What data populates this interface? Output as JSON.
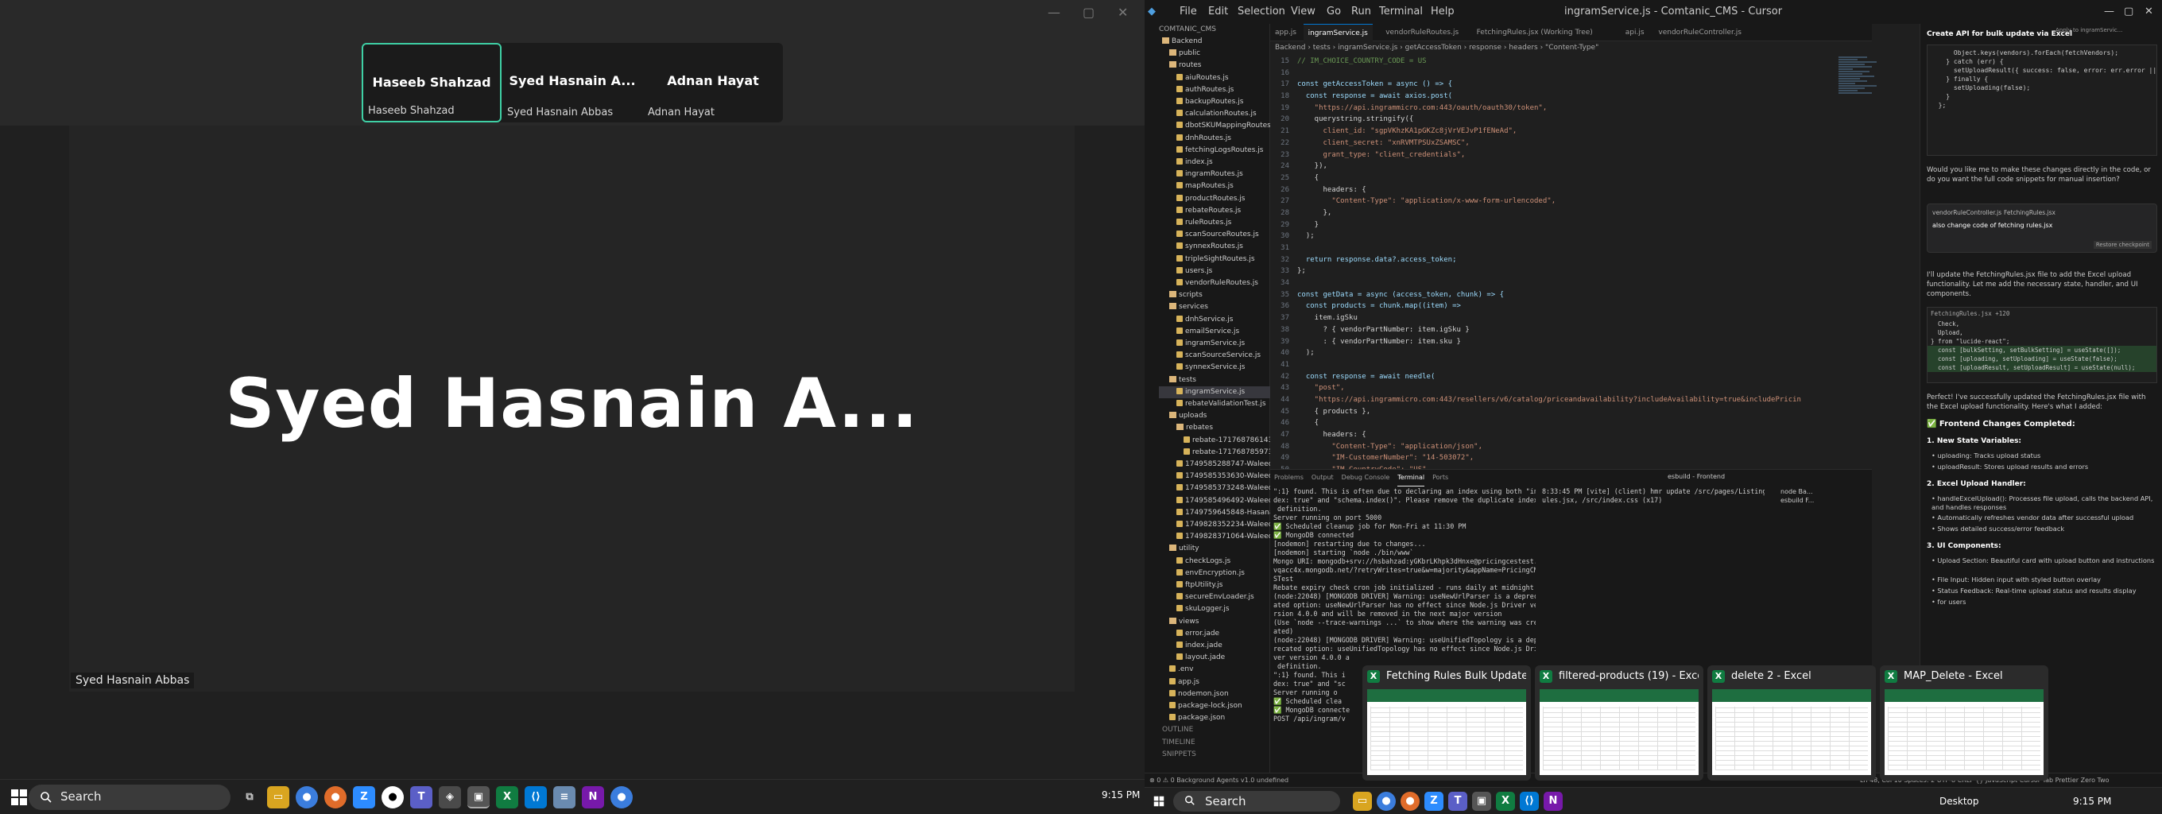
{
  "meeting": {
    "window_controls": [
      "—",
      "▢",
      "✕"
    ],
    "tiles": [
      {
        "name": "Haseeb Shahzad",
        "label": "Haseeb Shahzad",
        "active": true
      },
      {
        "name": "Syed Hasnain A...",
        "label": "Syed Hasnain Abbas",
        "active": false
      },
      {
        "name": "Adnan Hayat",
        "label": "Adnan Hayat",
        "active": false
      }
    ],
    "speaker_name": "Syed Hasnain A...",
    "speaker_label": "Syed Hasnain Abbas"
  },
  "taskbar1": {
    "search_placeholder": "Search",
    "time": "9:15 PM",
    "apps": [
      "file-explorer",
      "chrome",
      "chrome",
      "zoom",
      "chrome-dev",
      "app",
      "teams",
      "app",
      "excel",
      "vscode",
      "notepad",
      "onenote",
      "chrome"
    ]
  },
  "ide": {
    "window_title": "ingramService.js - Comtanic_CMS - Cursor",
    "menu": [
      "File",
      "Edit",
      "Selection",
      "View",
      "Go",
      "Run",
      "Terminal",
      "Help"
    ],
    "tabs": [
      "app.js",
      "ingramService.js",
      "vendorRuleRoutes.js",
      "FetchingRules.jsx (Working Tree)",
      "api.js",
      "vendorRuleController.js"
    ],
    "breadcrumb": "Backend › tests › ingramService.js › getAccessToken › response › headers › \"Content-Type\"",
    "explorer_title": "COMTANIC_CMS",
    "explorer": [
      {
        "label": "Backend",
        "type": "folder",
        "indent": 0
      },
      {
        "label": "public",
        "type": "folder",
        "indent": 1
      },
      {
        "label": "routes",
        "type": "folder",
        "indent": 1
      },
      {
        "label": "aiuRoutes.js",
        "type": "file",
        "indent": 2
      },
      {
        "label": "authRoutes.js",
        "type": "file",
        "indent": 2
      },
      {
        "label": "backupRoutes.js",
        "type": "file",
        "indent": 2
      },
      {
        "label": "calculationRoutes.js",
        "type": "file",
        "indent": 2
      },
      {
        "label": "dbotSKUMappingRoutes.js",
        "type": "file",
        "indent": 2
      },
      {
        "label": "dnhRoutes.js",
        "type": "file",
        "indent": 2
      },
      {
        "label": "fetchingLogsRoutes.js",
        "type": "file",
        "indent": 2
      },
      {
        "label": "index.js",
        "type": "file",
        "indent": 2
      },
      {
        "label": "ingramRoutes.js",
        "type": "file",
        "indent": 2
      },
      {
        "label": "mapRoutes.js",
        "type": "file",
        "indent": 2
      },
      {
        "label": "productRoutes.js",
        "type": "file",
        "indent": 2
      },
      {
        "label": "rebateRoutes.js",
        "type": "file",
        "indent": 2
      },
      {
        "label": "ruleRoutes.js",
        "type": "file",
        "indent": 2
      },
      {
        "label": "scanSourceRoutes.js",
        "type": "file",
        "indent": 2
      },
      {
        "label": "synnexRoutes.js",
        "type": "file",
        "indent": 2
      },
      {
        "label": "tripleSightRoutes.js",
        "type": "file",
        "indent": 2
      },
      {
        "label": "users.js",
        "type": "file",
        "indent": 2
      },
      {
        "label": "vendorRuleRoutes.js",
        "type": "file",
        "indent": 2
      },
      {
        "label": "scripts",
        "type": "folder",
        "indent": 1
      },
      {
        "label": "services",
        "type": "folder",
        "indent": 1
      },
      {
        "label": "dnhService.js",
        "type": "file",
        "indent": 2
      },
      {
        "label": "emailService.js",
        "type": "file",
        "indent": 2
      },
      {
        "label": "ingramService.js",
        "type": "file",
        "indent": 2
      },
      {
        "label": "scanSourceService.js",
        "type": "file",
        "indent": 2
      },
      {
        "label": "synnexService.js",
        "type": "file",
        "indent": 2
      },
      {
        "label": "tests",
        "type": "folder",
        "indent": 1
      },
      {
        "label": "ingramService.js",
        "type": "file",
        "indent": 2,
        "selected": true
      },
      {
        "label": "rebateValidationTest.js",
        "type": "file",
        "indent": 2
      },
      {
        "label": "uploads",
        "type": "folder",
        "indent": 1
      },
      {
        "label": "rebates",
        "type": "folder",
        "indent": 2
      },
      {
        "label": "rebate-1717687861434-1...",
        "type": "file",
        "indent": 3
      },
      {
        "label": "rebate-1717687859733-8...",
        "type": "file",
        "indent": 3
      },
      {
        "label": "1749585288747-Waleed ay...",
        "type": "file",
        "indent": 2
      },
      {
        "label": "1749585353630-Waleed ay...",
        "type": "file",
        "indent": 2
      },
      {
        "label": "1749585373248-Waleed ay...",
        "type": "file",
        "indent": 2
      },
      {
        "label": "1749585496492-Waleed ay...",
        "type": "file",
        "indent": 2
      },
      {
        "label": "1749759645848-Hasanat/A...",
        "type": "file",
        "indent": 2
      },
      {
        "label": "1749828352234-Waleed_m...",
        "type": "file",
        "indent": 2
      },
      {
        "label": "1749828371064-Waleed_m...",
        "type": "file",
        "indent": 2
      },
      {
        "label": "utility",
        "type": "folder",
        "indent": 1
      },
      {
        "label": "checkLogs.js",
        "type": "file",
        "indent": 2
      },
      {
        "label": "envEncryption.js",
        "type": "file",
        "indent": 2
      },
      {
        "label": "ftpUtility.js",
        "type": "file",
        "indent": 2
      },
      {
        "label": "secureEnvLoader.js",
        "type": "file",
        "indent": 2
      },
      {
        "label": "skuLogger.js",
        "type": "file",
        "indent": 2
      },
      {
        "label": "views",
        "type": "folder",
        "indent": 1
      },
      {
        "label": "error.jade",
        "type": "file",
        "indent": 2
      },
      {
        "label": "index.jade",
        "type": "file",
        "indent": 2
      },
      {
        "label": "layout.jade",
        "type": "file",
        "indent": 2
      },
      {
        "label": ".env",
        "type": "file",
        "indent": 1
      },
      {
        "label": "app.js",
        "type": "file",
        "indent": 1
      },
      {
        "label": "nodemon.json",
        "type": "file",
        "indent": 1
      },
      {
        "label": "package-lock.json",
        "type": "file",
        "indent": 1
      },
      {
        "label": "package.json",
        "type": "file",
        "indent": 1
      },
      {
        "label": "OUTLINE",
        "type": "section",
        "indent": 0
      },
      {
        "label": "TIMELINE",
        "type": "section",
        "indent": 0
      },
      {
        "label": "SNIPPETS",
        "type": "section",
        "indent": 0
      }
    ],
    "code_start_line": 15,
    "code": [
      "// IM_CHOICE_COUNTRY_CODE = US",
      "",
      "const getAccessToken = async () => {",
      "  const response = await axios.post(",
      "    \"https://api.ingrammicro.com:443/oauth/oauth30/token\",",
      "    querystring.stringify({",
      "      client_id: \"sgpVKhzKA1pGKZc8jVrVEJvP1fENeAd\",",
      "      client_secret: \"xnRVMTPSUxZSAMSC\",",
      "      grant_type: \"client_credentials\",",
      "    }),",
      "    {",
      "      headers: {",
      "        \"Content-Type\": \"application/x-www-form-urlencoded\",",
      "      },",
      "    }",
      "  );",
      "",
      "  return response.data?.access_token;",
      "};",
      "",
      "const getData = async (access_token, chunk) => {",
      "  const products = chunk.map((item) =>",
      "    item.igSku",
      "      ? { vendorPartNumber: item.igSku }",
      "      : { vendorPartNumber: item.sku }",
      "  );",
      "",
      "  const response = await needle(",
      "    \"post\",",
      "    \"https://api.ingrammicro.com:443/resellers/v6/catalog/priceandavailability?includeAvailability=true&includePricin",
      "    { products },",
      "    {",
      "      headers: {",
      "        \"Content-Type\": \"application/json\",",
      "        \"IM-CustomerNumber\": \"14-503072\",",
      "        \"IM-CountryCode\": \"US\",",
      "        \"IM-CorrelationID\": uuidv4(),",
      "        Authorization: \"Bearer \" + access_token,",
      "      },"
    ],
    "panel_tabs": [
      "Problems",
      "Output",
      "Debug Console",
      "Terminal",
      "Ports"
    ],
    "terminal_left": [
      "\":1} found. This is often due to declaring an index using both \"in",
      "dex: true\" and \"schema.index()\". Please remove the duplicate index",
      " definition.",
      "Server running on port 5000",
      "✅ Scheduled cleanup job for Mon-Fri at 11:30 PM",
      "✅ MongoDB connected",
      "[nodemon] restarting due to changes...",
      "[nodemon] starting `node ./bin/www`",
      "Mongo URI: mongodb+srv://hsbahzad:yGKbrLKhpk3dHnxe@pricingcestest.",
      "vqacc4x.mongodb.net/?retryWrites=true&w=majority&appName=PricingCM",
      "STest",
      "Rebate expiry check cron job initialized - runs daily at midnight",
      "(node:22048) [MONGODB DRIVER] Warning: useNewUrlParser is a deprec",
      "ated option: useNewUrlParser has no effect since Node.js Driver ve",
      "rsion 4.0.0 and will be removed in the next major version",
      "(Use `node --trace-warnings ...` to show where the warning was cre",
      "ated)",
      "(node:22048) [MONGODB DRIVER] Warning: useUnifiedTopology is a dep",
      "recated option: useUnifiedTopology has no effect since Node.js Dri",
      "ver version 4.0.0 a",
      " definition.",
      "\":1} found. This i",
      "dex: true\" and \"sc",
      "Server running o",
      "✅ Scheduled clea",
      "✅ MongoDB connecte",
      "POST /api/ingram/v"
    ],
    "terminal_right": [
      "8:33:45 PM [vite] (client) hmr update /src/pages/Listings/FetchingR",
      "ules.jsx, /src/index.css (x17)"
    ],
    "terminal_list": [
      "node Ba...",
      "esbuild F..."
    ],
    "terminal_name": "esbuild - Frontend",
    "status_left": "⊗ 0 ⚠ 0   Background Agents   v1.0 undefined",
    "status_right": "Ln 48, Col 10   Spaces: 2   UTF-8   CRLF   {} JavaScript   Cursor Tab   Prettier   Zero Two"
  },
  "chat": {
    "title": "Create API for bulk update via Excel",
    "code_snippet": "      Object.keys(vendors).forEach(fetchVendors);\n    } catch (err) {\n      setUploadResult({ success: false, error: err.error || '\n    } finally {\n      setUploading(false);\n    }\n  };",
    "apply_label": "Apply to ingramServic...",
    "question": "Would you like me to make these changes directly in the code, or do you want the full code snippets for manual insertion?",
    "user_files": [
      "vendorRuleController.js",
      "FetchingRules.jsx"
    ],
    "user_msg": "also change code of fetching rules.jsx",
    "restore": "Restore checkpoint",
    "reply1": "I'll update the FetchingRules.jsx file to add the Excel upload functionality. Let me add the necessary state, handler, and UI components.",
    "diff_file": "FetchingRules.jsx +120",
    "diff_lines": [
      "  Check,",
      "  Upload,",
      "} from \"lucide-react\";",
      "",
      "  const [bulkSetting, setBulkSetting] = useState([]);",
      "  const [uploading, setUploading] = useState(false);",
      "  const [uploadResult, setUploadResult] = useState(null);"
    ],
    "reply2": "Perfect! I've successfully updated the FetchingRules.jsx file with the Excel upload functionality. Here's what I added:",
    "heading": "✅ Frontend Changes Completed:",
    "sections": [
      {
        "title": "1. New State Variables:",
        "items": [
          "uploading: Tracks upload status",
          "uploadResult: Stores upload results and errors"
        ]
      },
      {
        "title": "2. Excel Upload Handler:",
        "items": [
          "handleExcelUpload(): Processes file upload, calls the backend API, and handles responses",
          "Automatically refreshes vendor data after successful upload",
          "Shows detailed success/error feedback"
        ]
      },
      {
        "title": "3. UI Components:",
        "items": [
          "Upload Section: Beautiful card with upload button and instructions",
          "File Input: Hidden input with styled button overlay",
          "Status Feedback: Real-time upload status and results display",
          "for users"
        ]
      }
    ]
  },
  "previews": [
    {
      "title": "Fetching Rules Bulk Update - Ex..."
    },
    {
      "title": "filtered-products (19) - Excel"
    },
    {
      "title": "delete 2 - Excel"
    },
    {
      "title": "MAP_Delete - Excel"
    }
  ],
  "taskbar2": {
    "search_placeholder": "Search",
    "desktop_label": "Desktop",
    "time": "9:15 PM"
  },
  "colors": {
    "accent": "#3fd0a5",
    "vscode_blue": "#0078d4",
    "excel_green": "#107c41"
  }
}
